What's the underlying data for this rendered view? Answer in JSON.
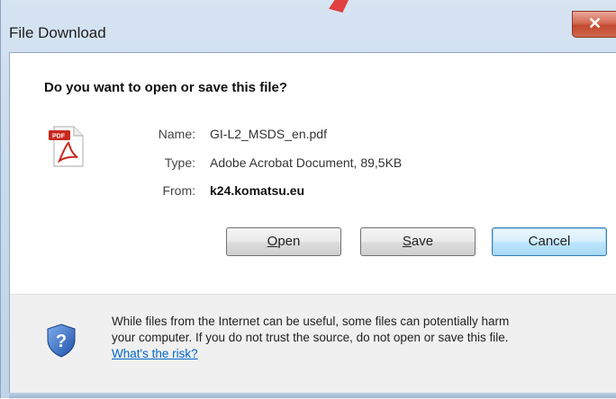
{
  "window": {
    "title": "File Download",
    "close_label": "✕"
  },
  "dialog": {
    "question": "Do you want to open or save this file?",
    "file": {
      "name_label": "Name:",
      "name_value": "GI-L2_MSDS_en.pdf",
      "type_label": "Type:",
      "type_value": "Adobe Acrobat Document, 89,5KB",
      "from_label": "From:",
      "from_value": "k24.komatsu.eu"
    },
    "buttons": {
      "open_mnemonic": "O",
      "open_rest": "pen",
      "save_mnemonic": "S",
      "save_rest": "ave",
      "cancel": "Cancel"
    },
    "warning": {
      "line1": "While files from the Internet can be useful, some files can potentially harm",
      "line2": "your computer. If you do not trust the source, do not open or save this file.",
      "link": "What's the risk?"
    }
  },
  "icons": {
    "file_icon": "pdf-file-icon",
    "security_icon": "shield-question-icon",
    "close_icon": "close-icon"
  },
  "colors": {
    "close_button": "#c14a2f",
    "link": "#0066cc",
    "default_button_border": "#3c7fb1"
  }
}
